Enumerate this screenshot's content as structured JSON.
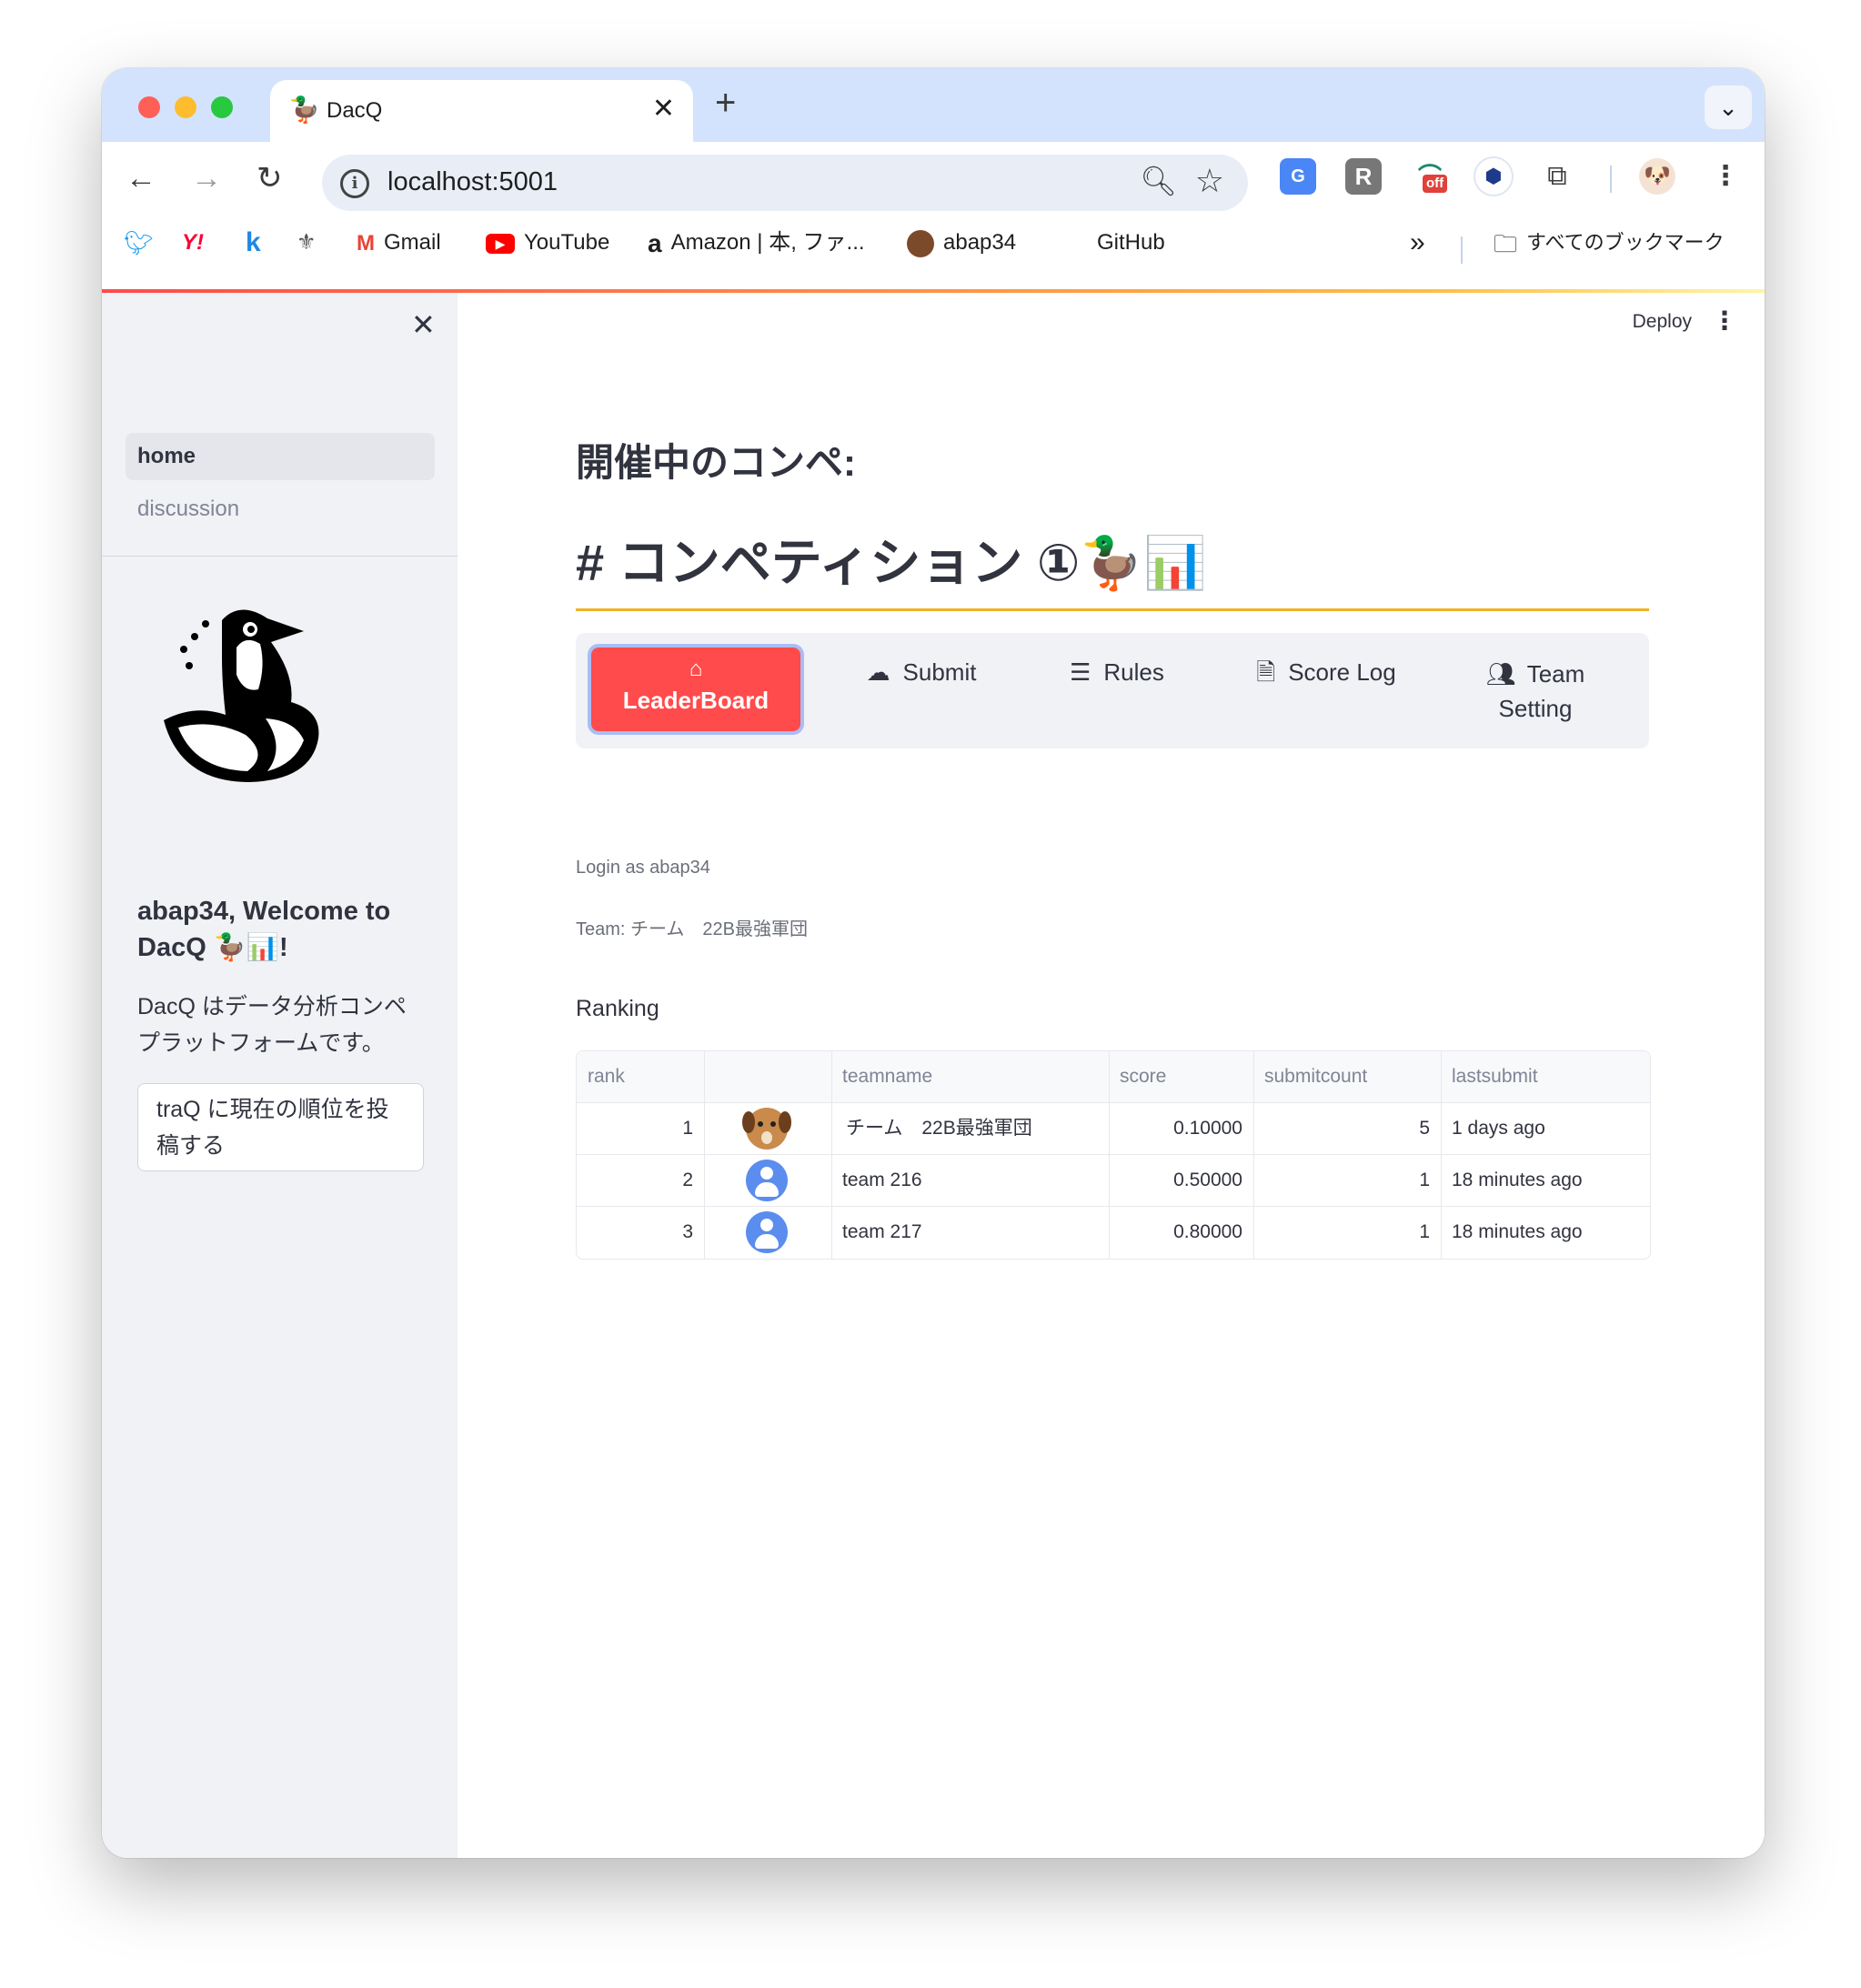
{
  "browser": {
    "tab_title": "DacQ",
    "url": "localhost:5001",
    "bookmarks": [
      {
        "icon": "twitter-icon",
        "label": ""
      },
      {
        "icon": "yahoo-icon",
        "label": ""
      },
      {
        "icon": "k-icon",
        "label": ""
      },
      {
        "icon": "crest-icon",
        "label": ""
      },
      {
        "icon": "gmail-icon",
        "label": "Gmail"
      },
      {
        "icon": "youtube-icon",
        "label": "YouTube"
      },
      {
        "icon": "amazon-icon",
        "label": "Amazon | 本, ファ..."
      },
      {
        "icon": "avatar-icon",
        "label": "abap34"
      },
      {
        "icon": "github-icon",
        "label": "GitHub"
      }
    ],
    "all_bookmarks_label": "すべてのブックマーク",
    "extension_off_badge": "off"
  },
  "sidebar": {
    "nav": [
      {
        "label": "home"
      },
      {
        "label": "discussion"
      }
    ],
    "welcome": "abap34, Welcome to DacQ 🦆📊!",
    "description": "DacQ はデータ分析コンペプラットフォームです。",
    "post_button": "traQ に現在の順位を投稿する"
  },
  "header": {
    "deploy_label": "Deploy"
  },
  "main": {
    "heading_sub": "開催中のコンペ:",
    "heading_main": "# コンペティション ①🦆📊",
    "tabs": [
      {
        "label": "LeaderBoard",
        "icon": "home-icon",
        "active": true
      },
      {
        "label": "Submit",
        "icon": "upload-cloud-icon",
        "active": false
      },
      {
        "label": "Rules",
        "icon": "list-icon",
        "active": false
      },
      {
        "label": "Score Log",
        "icon": "document-icon",
        "active": false
      },
      {
        "label": "Team Setting",
        "icon": "people-icon",
        "active": false
      }
    ],
    "login_text": "Login as abap34",
    "team_text": "Team: チーム　22B最強軍団",
    "ranking_title": "Ranking",
    "table": {
      "columns": [
        "rank",
        "",
        "teamname",
        "score",
        "submitcount",
        "lastsubmit"
      ],
      "rows": [
        {
          "rank": "1",
          "icon": "dog-avatar",
          "teamname": "チーム　22B最強軍団",
          "score": "0.10000",
          "submitcount": "5",
          "lastsubmit": "1 days ago"
        },
        {
          "rank": "2",
          "icon": "default-user-avatar",
          "teamname": "team 216",
          "score": "0.50000",
          "submitcount": "1",
          "lastsubmit": "18 minutes ago"
        },
        {
          "rank": "3",
          "icon": "default-user-avatar",
          "teamname": "team 217",
          "score": "0.80000",
          "submitcount": "1",
          "lastsubmit": "18 minutes ago"
        }
      ]
    }
  },
  "colors": {
    "accent": "#ff4b4b",
    "sidebar_bg": "#f0f2f6",
    "heading_rule": "#f0b323",
    "chrome_frame": "#d3e3fd"
  }
}
